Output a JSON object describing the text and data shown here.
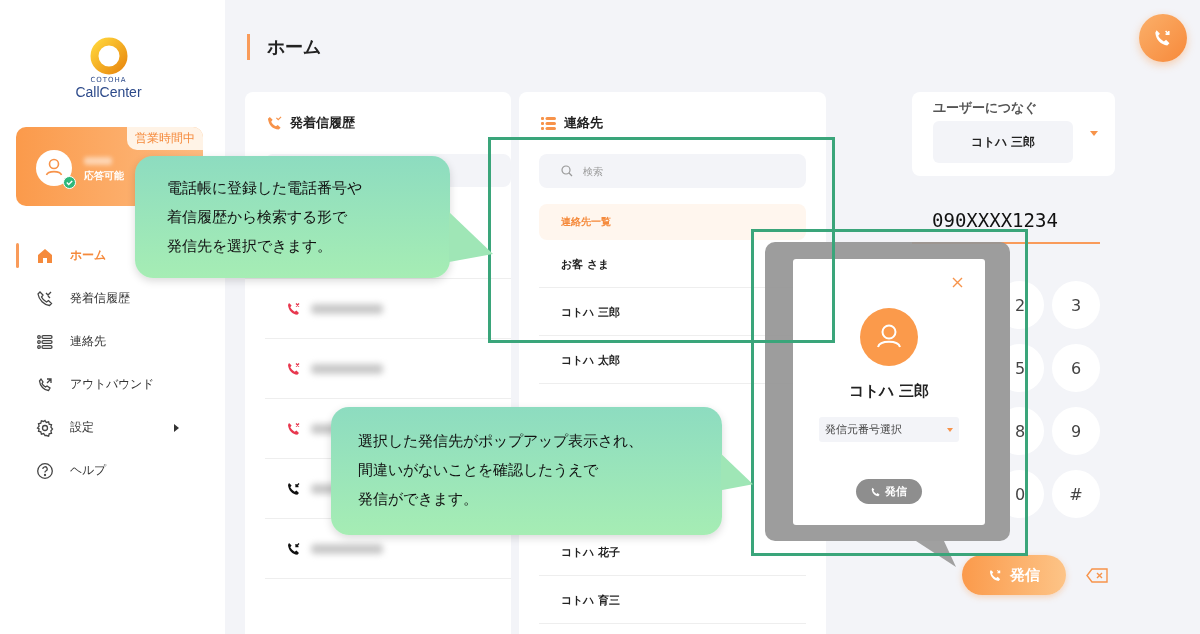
{
  "sidebar": {
    "logo": {
      "small": "COTOHA",
      "name": "CallCenter"
    },
    "status": {
      "badge": "営業時間中",
      "state": "応答可能",
      "available": true
    },
    "nav": [
      {
        "label": "ホーム",
        "selected": true,
        "has_submenu": false
      },
      {
        "label": "発着信履歴",
        "selected": false,
        "has_submenu": false
      },
      {
        "label": "連絡先",
        "selected": false,
        "has_submenu": false
      },
      {
        "label": "アウトバウンド",
        "selected": false,
        "has_submenu": false
      },
      {
        "label": "設定",
        "selected": false,
        "has_submenu": true
      },
      {
        "label": "ヘルプ",
        "selected": false,
        "has_submenu": false
      }
    ]
  },
  "page_title": "ホーム",
  "history": {
    "title": "発着信履歴",
    "rows": [
      {
        "kind": "missed"
      },
      {
        "kind": "missed"
      },
      {
        "kind": "missed"
      },
      {
        "kind": "outgoing"
      },
      {
        "kind": "outgoing"
      }
    ]
  },
  "contacts": {
    "title": "連絡先",
    "search": {
      "placeholder": "検索"
    },
    "group": "連絡先一覧",
    "rows": [
      {
        "name": "お客 さま"
      },
      {
        "name": "コトハ 三郎"
      },
      {
        "name": "コトハ 太郎"
      },
      {
        "name": "コトハ 花子"
      },
      {
        "name": "コトハ 育三"
      }
    ]
  },
  "dialer": {
    "connect_label": "ユーザーにつなぐ",
    "connect_user": "コトハ 三郎",
    "number": "090XXXX1234",
    "keys": [
      "2",
      "3",
      "5",
      "6",
      "8",
      "9",
      "0",
      "#"
    ],
    "call": "発信"
  },
  "popup": {
    "name": "コトハ 三郎",
    "source_select": "発信元番号選択",
    "call": "発信",
    "call_disabled": true
  },
  "callouts": [
    {
      "lines": [
        "電話帳に登録した電話番号や",
        "着信履歴から検索する形で",
        "発信先を選択できます。"
      ]
    },
    {
      "lines": [
        "選択した発信先がポップアップ表示され、",
        "間違いがないことを確認したうえで",
        "発信ができます。"
      ]
    }
  ]
}
